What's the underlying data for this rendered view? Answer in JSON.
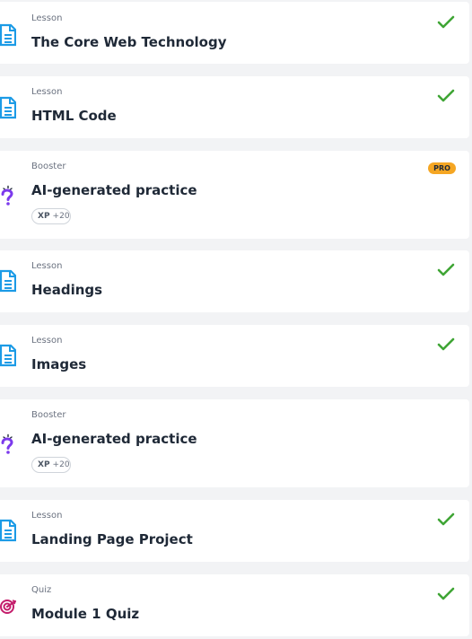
{
  "items": [
    {
      "type": "Lesson",
      "title": "The Core Web Technology",
      "icon": "lesson-doc-icon",
      "status": "completed-check-icon"
    },
    {
      "type": "Lesson",
      "title": "HTML Code",
      "icon": "lesson-doc-icon",
      "status": "completed-check-icon"
    },
    {
      "type": "Booster",
      "title": "AI-generated practice",
      "icon": "question-mark-icon",
      "badge": "PRO",
      "xp_label": "XP",
      "xp_value": "+20"
    },
    {
      "type": "Lesson",
      "title": "Headings",
      "icon": "lesson-doc-icon",
      "status": "completed-check-icon"
    },
    {
      "type": "Lesson",
      "title": "Images",
      "icon": "lesson-doc-icon",
      "status": "completed-check-icon"
    },
    {
      "type": "Booster",
      "title": "AI-generated practice",
      "icon": "question-mark-icon",
      "xp_label": "XP",
      "xp_value": "+20"
    },
    {
      "type": "Lesson",
      "title": "Landing Page Project",
      "icon": "lesson-doc-icon",
      "status": "completed-check-icon"
    },
    {
      "type": "Quiz",
      "title": "Module 1 Quiz",
      "icon": "target-icon",
      "status": "completed-check-icon"
    }
  ],
  "colors": {
    "lesson_icon": "#1c9be6",
    "booster_icon": "#7c3aed",
    "quiz_icon": "#c41d6b",
    "check": "#3fa535",
    "pro_badge": "#f5a623"
  }
}
